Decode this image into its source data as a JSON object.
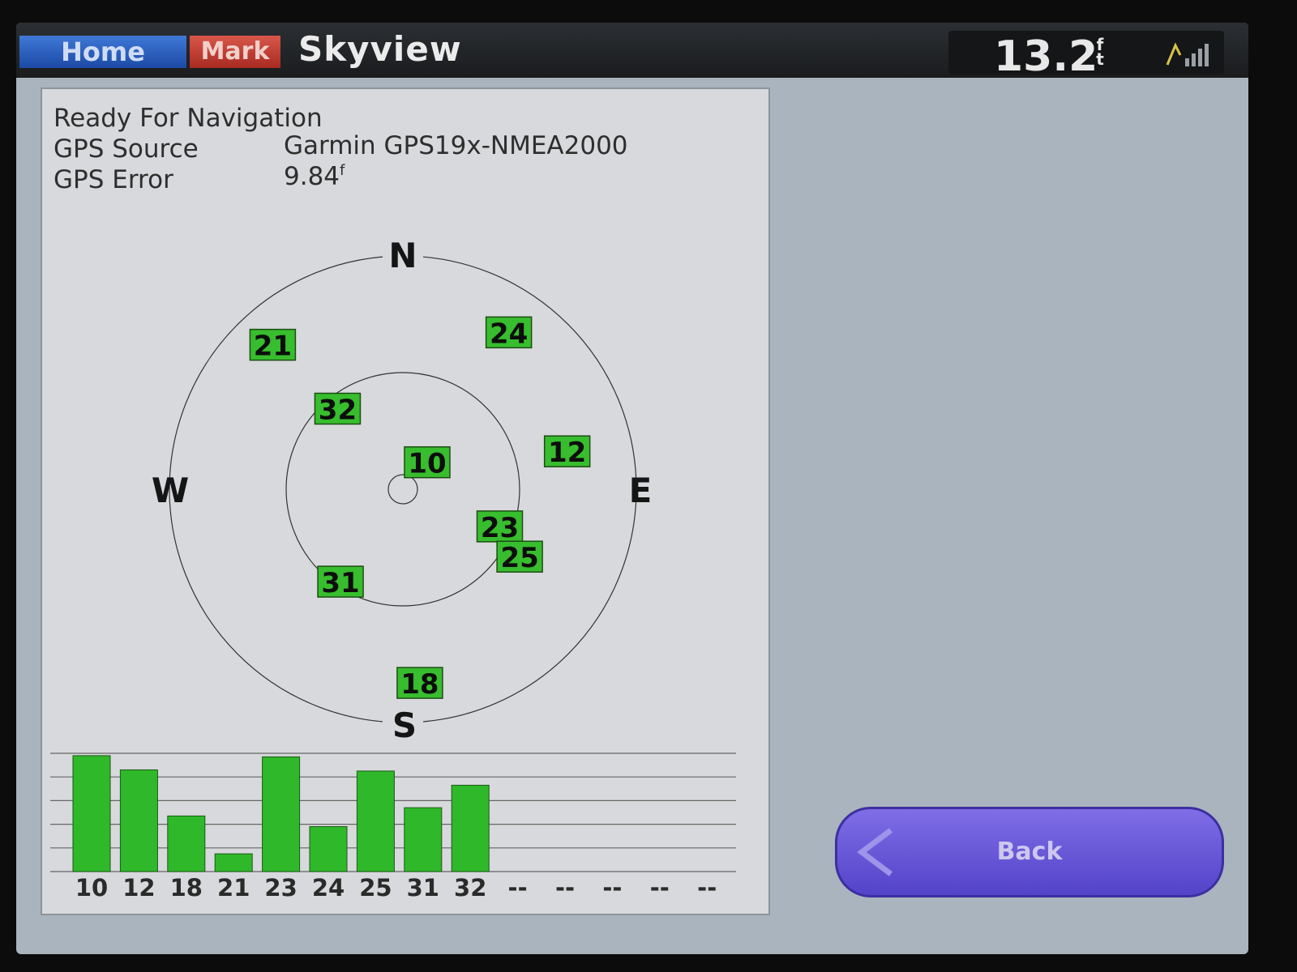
{
  "header": {
    "home_label": "Home",
    "mark_label": "Mark",
    "title": "Skyview",
    "depth_value": "13.2",
    "depth_unit_top": "f",
    "depth_unit_bottom": "t",
    "signal_icon": "gps-signal-bars-icon"
  },
  "status": {
    "ready_text": "Ready For Navigation",
    "source_label": "GPS Source",
    "source_value": "Garmin GPS19x-NMEA2000",
    "error_label": "GPS Error",
    "error_value": "9.84",
    "error_unit_glyph": "f"
  },
  "compass": {
    "n": "N",
    "e": "E",
    "s": "S",
    "w": "W"
  },
  "satellites": [
    {
      "id": "21",
      "azimuth_deg": 318,
      "elevation_deg": 15
    },
    {
      "id": "24",
      "azimuth_deg": 34,
      "elevation_deg": 17
    },
    {
      "id": "32",
      "azimuth_deg": 321,
      "elevation_deg": 50
    },
    {
      "id": "10",
      "azimuth_deg": 42,
      "elevation_deg": 76
    },
    {
      "id": "12",
      "azimuth_deg": 77,
      "elevation_deg": 25
    },
    {
      "id": "23",
      "azimuth_deg": 111,
      "elevation_deg": 50
    },
    {
      "id": "25",
      "azimuth_deg": 120,
      "elevation_deg": 38
    },
    {
      "id": "31",
      "azimuth_deg": 214,
      "elevation_deg": 47
    },
    {
      "id": "18",
      "azimuth_deg": 175,
      "elevation_deg": 15
    }
  ],
  "chart_data": {
    "type": "bar",
    "categories": [
      "10",
      "12",
      "18",
      "21",
      "23",
      "24",
      "25",
      "31",
      "32",
      "--",
      "--",
      "--",
      "--",
      "--"
    ],
    "values": [
      98,
      86,
      47,
      15,
      97,
      38,
      85,
      54,
      73,
      null,
      null,
      null,
      null,
      null
    ],
    "ylim": [
      0,
      100
    ],
    "grid": true,
    "bar_color": "#2fb82a"
  },
  "back_button": {
    "label": "Back",
    "icon": "chevron-left-icon"
  },
  "colors": {
    "sat_fill": "#37bd2d",
    "bar_fill": "#2fb82a",
    "home_button": "#2a5fc4",
    "mark_button": "#c2392f",
    "back_button": "#6a59d8"
  }
}
